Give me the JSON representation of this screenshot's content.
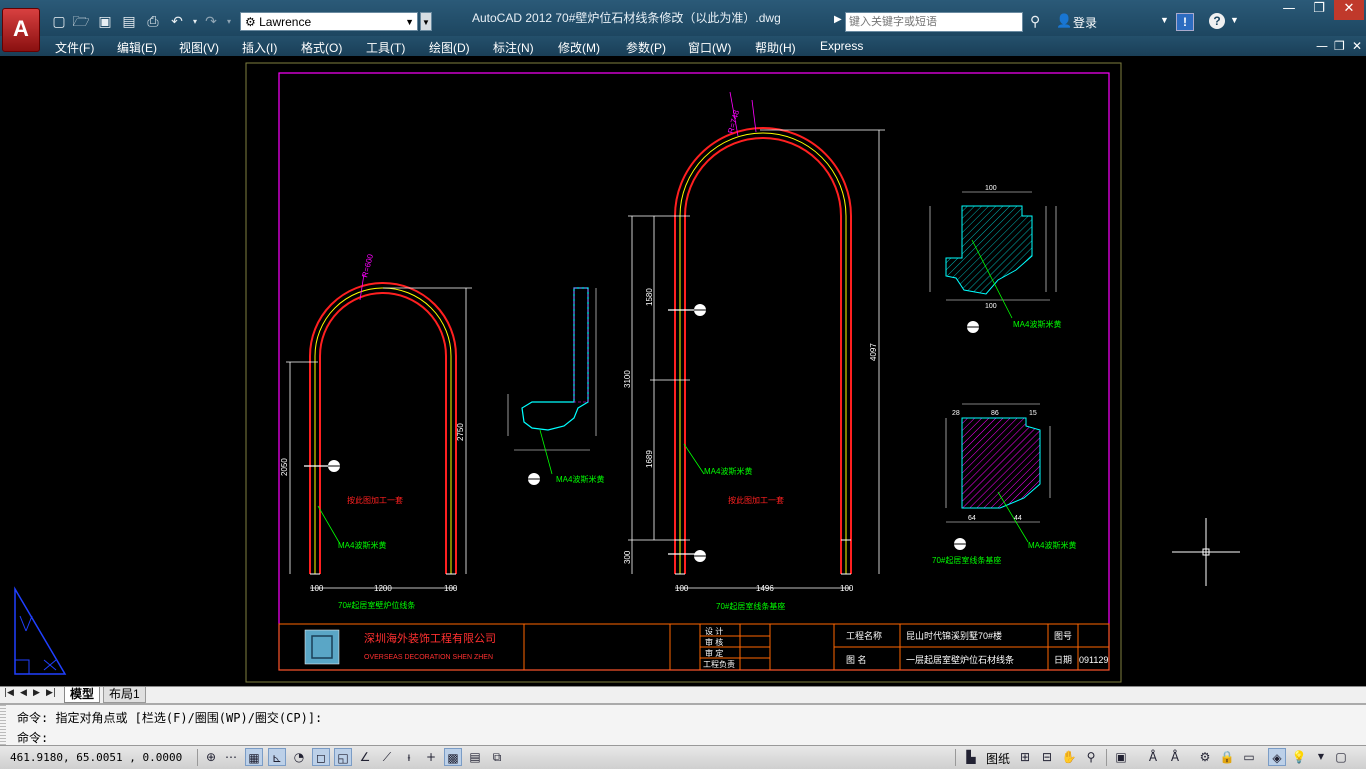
{
  "titlebar": {
    "app_button": "A",
    "workspace": "Lawrence",
    "title": "AutoCAD 2012      70#壁炉位石材线条修改（以此为准）.dwg",
    "search_placeholder": "键入关键字或短语",
    "login": "登录",
    "help": "?",
    "exchange": "!"
  },
  "qat_icons": [
    "new-icon",
    "open-icon",
    "save-icon",
    "saveas-icon",
    "print-icon",
    "undo-icon",
    "redo-icon"
  ],
  "menu": {
    "items": [
      "文件(F)",
      "编辑(E)",
      "视图(V)",
      "插入(I)",
      "格式(O)",
      "工具(T)",
      "绘图(D)",
      "标注(N)",
      "修改(M)",
      "参数(P)",
      "窗口(W)",
      "帮助(H)",
      "Express"
    ]
  },
  "drawing": {
    "left_arch": {
      "width_dim": "1200",
      "side_dim_left": "100",
      "side_dim_right": "100",
      "height_dim": "2050",
      "height_dim_right": "2750",
      "radius_label": "R=600",
      "center_note": "按此图加工一套",
      "material": "MA4波斯米黄",
      "caption": "70#起居室壁炉位线条"
    },
    "right_arch": {
      "width_dim": "1496",
      "side_dim_left": "100",
      "side_dim_right": "100",
      "height_dim_total": "3100",
      "height_dim_right": "4097",
      "height_dim_a": "1580",
      "height_dim_b": "1689",
      "base_dim": "300",
      "radius_label": "R=748",
      "center_note": "按此图加工一套",
      "material": "MA4波斯米黄",
      "caption": "70#起居室线条基座"
    },
    "mid_profile": {
      "material": "MA4波斯米黄"
    },
    "top_right_profile": {
      "top_dim": "100",
      "bottom_dim": "100",
      "material": "MA4波斯米黄"
    },
    "bottom_right_profile": {
      "top_dim_a": "28",
      "top_dim_b": "86",
      "top_dim_c": "15",
      "bottom_dim_a": "64",
      "bottom_dim_b": "44",
      "material": "MA4波斯米黄",
      "caption": "70#起居室线条基座"
    },
    "title_block": {
      "company_cn": "深圳海外装饰工程有限公司",
      "company_en": "OVERSEAS DECORATION SHEN ZHEN",
      "roles": [
        "设  计",
        "审  核",
        "审  定",
        "工程负责"
      ],
      "project_label": "工程名称",
      "project_value": "昆山时代锦溪别墅70#楼",
      "drawing_label": "图    名",
      "drawing_value": "一层起居室壁炉位石材线条",
      "number_label": "图号",
      "date_label": "日期",
      "date_value": "091129"
    }
  },
  "tabs": {
    "model": "模型",
    "layout1": "布局1"
  },
  "command": {
    "history": "命令: 指定对角点或 [栏选(F)/圈围(WP)/圈交(CP)]:",
    "prompt": "命令:"
  },
  "status": {
    "coords": "461.9180, 65.0051 , 0.0000",
    "paper": "图纸"
  },
  "colors": {
    "accent_magenta": "#ff00ff",
    "arch_red": "#ff2020",
    "dim_white": "#ffffff",
    "leader_green": "#00ff00",
    "title_bar": "#1d4660"
  }
}
